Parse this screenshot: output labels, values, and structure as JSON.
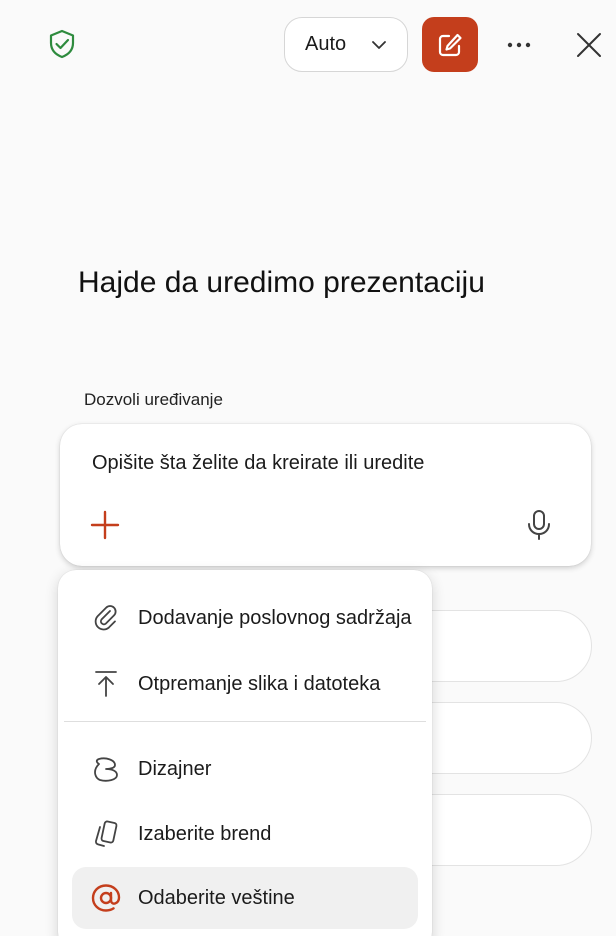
{
  "header": {
    "mode_select": {
      "value": "Auto"
    }
  },
  "main": {
    "title": "Hajde da uredimo prezentaciju",
    "allow_editing_label": "Dozvoli uređivanje",
    "composer": {
      "placeholder": "Opišite šta želite da kreirate ili uredite"
    }
  },
  "menu": {
    "items": [
      {
        "label": "Dodavanje poslovnog sadržaja",
        "icon": "paperclip-icon"
      },
      {
        "label": "Otpremanje slika i datoteka",
        "icon": "upload-icon"
      },
      {
        "label": "Dizajner",
        "icon": "designer-icon"
      },
      {
        "label": "Izaberite brend",
        "icon": "brand-icon"
      },
      {
        "label": "Odaberite veštine",
        "icon": "at-sign-icon",
        "selected": true
      }
    ]
  },
  "colors": {
    "accent": "#c43e1c",
    "shield": "#2e8b3e",
    "selected_item_bg": "#f0f0f0"
  }
}
